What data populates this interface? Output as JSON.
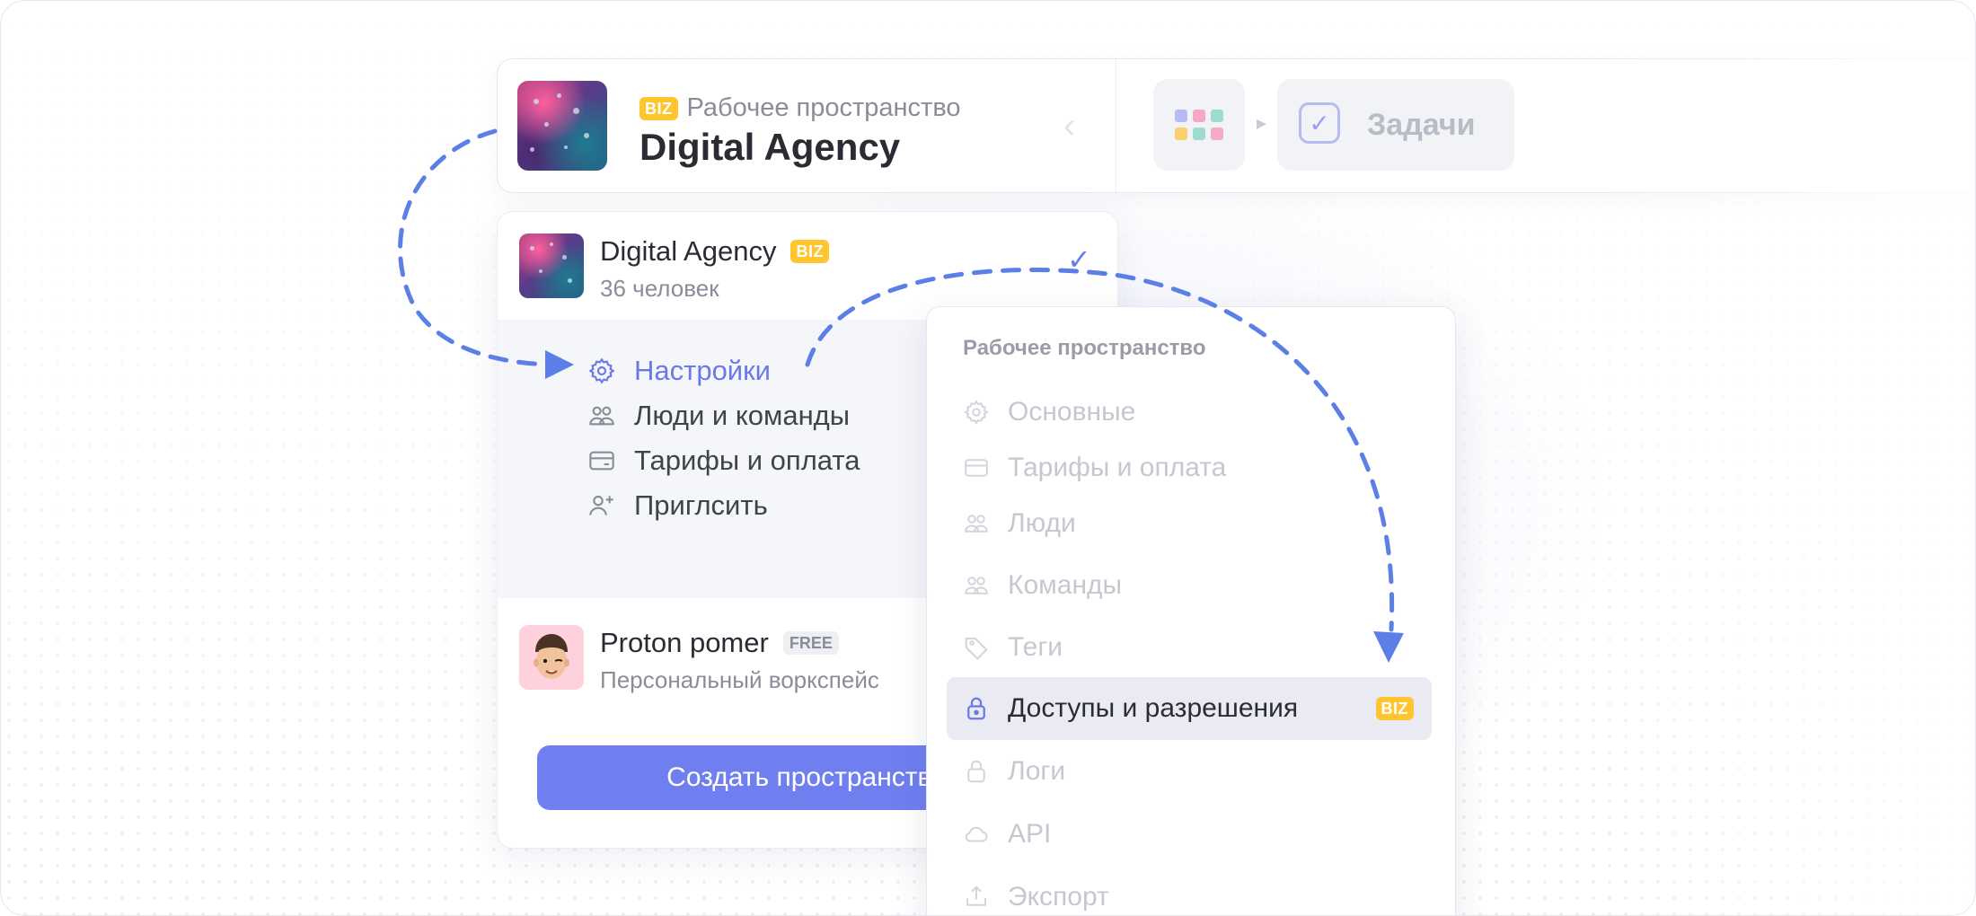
{
  "header": {
    "badge": "BIZ",
    "caption": "Рабочее пространство",
    "workspace_title": "Digital Agency",
    "breadcrumb_tasks": "Задачи",
    "app_grid_colors": [
      "#b6bbf5",
      "#f7a8c4",
      "#9edcd2",
      "#f9d06d",
      "#9edcd2",
      "#f7a8c4"
    ]
  },
  "workspace_menu": {
    "current": {
      "name": "Digital Agency",
      "badge": "BIZ",
      "members": "36 человек"
    },
    "items": [
      {
        "label": "Настройки",
        "icon": "gear-icon"
      },
      {
        "label": "Люди и команды",
        "icon": "people-icon"
      },
      {
        "label": "Тарифы и оплата",
        "icon": "card-icon"
      },
      {
        "label": "Приглсить",
        "icon": "add-user-icon"
      }
    ],
    "personal": {
      "name": "Proton pomer",
      "badge": "FREE",
      "subtitle": "Персональный воркспейс"
    },
    "create_button": "Создать пространство"
  },
  "settings_submenu": {
    "heading": "Рабочее пространство",
    "items": [
      {
        "label": "Основные",
        "icon": "gear-icon"
      },
      {
        "label": "Тарифы и оплата",
        "icon": "card-icon"
      },
      {
        "label": "Люди",
        "icon": "people-icon"
      },
      {
        "label": "Команды",
        "icon": "people-icon"
      },
      {
        "label": "Теги",
        "icon": "tag-icon"
      },
      {
        "label": "Доступы и разрешения",
        "icon": "lock-icon",
        "badge": "BIZ"
      },
      {
        "label": "Логи",
        "icon": "lock-icon"
      },
      {
        "label": "API",
        "icon": "cloud-icon"
      },
      {
        "label": "Экспорт",
        "icon": "export-icon"
      }
    ]
  },
  "colors": {
    "accent": "#6f7ff0",
    "biz_badge": "#ffc52e",
    "arrow": "#5b7fe6"
  }
}
